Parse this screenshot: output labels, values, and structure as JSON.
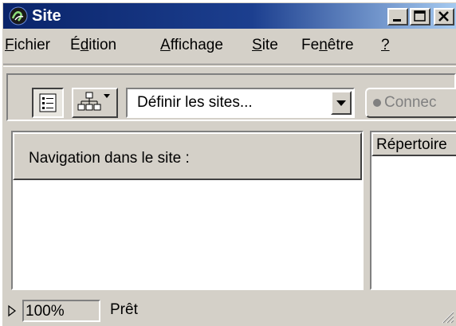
{
  "window": {
    "title": "Site"
  },
  "menu": {
    "items": [
      {
        "pre": "",
        "u": "F",
        "post": "ichier"
      },
      {
        "pre": "É",
        "u": "d",
        "post": "ition"
      },
      {
        "pre": "",
        "u": "A",
        "post": "ffichage"
      },
      {
        "pre": "",
        "u": "S",
        "post": "ite"
      },
      {
        "pre": "Fe",
        "u": "n",
        "post": "être"
      },
      {
        "pre": "",
        "u": "?",
        "post": ""
      }
    ]
  },
  "toolbar": {
    "site_selector_value": "Définir les sites...",
    "connect_label": "Connec"
  },
  "left_pane": {
    "header": "Navigation dans le site :"
  },
  "right_pane": {
    "column_header": "Répertoire"
  },
  "status": {
    "zoom": "100%",
    "text": "Prêt"
  },
  "icons": [
    "dreamweaver-app-icon",
    "minimize-icon",
    "maximize-icon",
    "close-icon",
    "list-view-icon",
    "site-map-icon",
    "dropdown-arrow-icon",
    "connect-status-icon",
    "expand-arrow-icon",
    "resize-grip-icon"
  ],
  "colors": {
    "titlebar_start": "#0a246a",
    "titlebar_end": "#a6caf0",
    "face": "#d4d0c8"
  }
}
